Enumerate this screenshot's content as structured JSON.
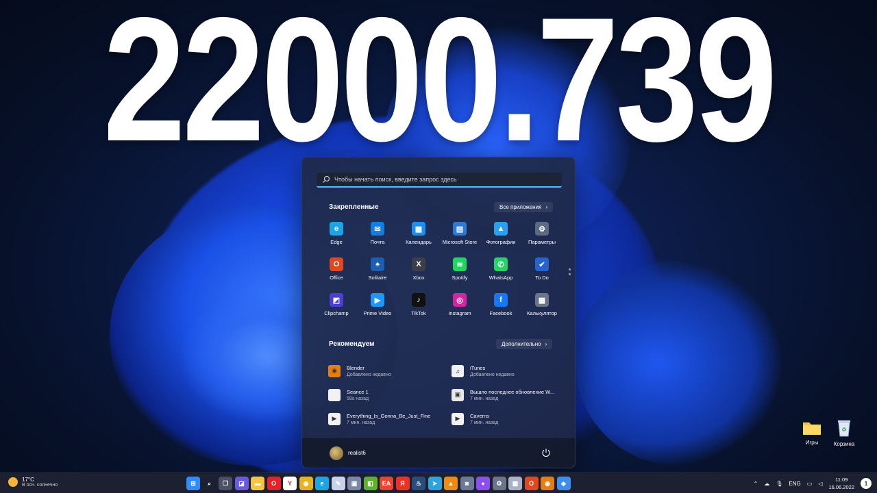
{
  "headline": "22000.739",
  "start_menu": {
    "search_placeholder": "Чтобы начать поиск, введите запрос здесь",
    "pinned_title": "Закрепленные",
    "all_apps_label": "Все приложения",
    "recommended_title": "Рекомендуем",
    "more_label": "Дополнительно",
    "pinned": [
      {
        "label": "Edge",
        "icon": "edge-icon",
        "color": "#1aa5e6",
        "glyph": "e"
      },
      {
        "label": "Почта",
        "icon": "mail-icon",
        "color": "#0f7fe0",
        "glyph": "✉"
      },
      {
        "label": "Календарь",
        "icon": "calendar-icon",
        "color": "#1e8ef0",
        "glyph": "▦"
      },
      {
        "label": "Microsoft Store",
        "icon": "store-icon",
        "color": "#2b7ad6",
        "glyph": "▤"
      },
      {
        "label": "Фотографии",
        "icon": "photos-icon",
        "color": "#2aa0f0",
        "glyph": "▲"
      },
      {
        "label": "Параметры",
        "icon": "settings-icon",
        "color": "#5d6a82",
        "glyph": "⚙"
      },
      {
        "label": "Office",
        "icon": "office-icon",
        "color": "#e2481f",
        "glyph": "O"
      },
      {
        "label": "Solitaire",
        "icon": "solitaire-icon",
        "color": "#1b5fb5",
        "glyph": "♠"
      },
      {
        "label": "Xbox",
        "icon": "xbox-icon",
        "color": "#3a3f4a",
        "glyph": "X"
      },
      {
        "label": "Spotify",
        "icon": "spotify-icon",
        "color": "#1ed760",
        "glyph": "≋"
      },
      {
        "label": "WhatsApp",
        "icon": "whatsapp-icon",
        "color": "#25d366",
        "glyph": "✆"
      },
      {
        "label": "To Do",
        "icon": "todo-icon",
        "color": "#2564cf",
        "glyph": "✔"
      },
      {
        "label": "Clipchamp",
        "icon": "clipchamp-icon",
        "color": "#4b3fd6",
        "glyph": "◩"
      },
      {
        "label": "Prime Video",
        "icon": "prime-video-icon",
        "color": "#1a98ff",
        "glyph": "▶"
      },
      {
        "label": "TikTok",
        "icon": "tiktok-icon",
        "color": "#111111",
        "glyph": "♪"
      },
      {
        "label": "Instagram",
        "icon": "instagram-icon",
        "color": "#d6249f",
        "glyph": "◎"
      },
      {
        "label": "Facebook",
        "icon": "facebook-icon",
        "color": "#1877f2",
        "glyph": "f"
      },
      {
        "label": "Калькулятор",
        "icon": "calculator-icon",
        "color": "#6b7589",
        "glyph": "▦"
      }
    ],
    "recommended": [
      {
        "name": "Blender",
        "sub": "Добавлено недавно",
        "icon": "blender-icon",
        "color": "#e87d0d",
        "glyph": "◉"
      },
      {
        "name": "iTunes",
        "sub": "Добавлено недавно",
        "icon": "itunes-icon",
        "color": "#f0f0f5",
        "glyph": "♫"
      },
      {
        "name": "Seance 1",
        "sub": "58s назад",
        "icon": "document-icon",
        "color": "#f2f2f2",
        "glyph": ""
      },
      {
        "name": "Вышло последнее обновление W...",
        "sub": "7 мин. назад",
        "icon": "image-file-icon",
        "color": "#e8e8e8",
        "glyph": "▣"
      },
      {
        "name": "Everything_Is_Gonna_Be_Just_Fine",
        "sub": "7 мин. назад",
        "icon": "video-file-icon",
        "color": "#f2f2f2",
        "glyph": "▶"
      },
      {
        "name": "Caverns",
        "sub": "7 мин. назад",
        "icon": "video-file-icon",
        "color": "#f2f2f2",
        "glyph": "▶"
      }
    ],
    "user": "realist6"
  },
  "desktop": [
    {
      "label": "Игры",
      "icon": "folder-icon"
    },
    {
      "label": "Корзина",
      "icon": "recycle-bin-icon"
    }
  ],
  "taskbar": {
    "weather_temp": "17°C",
    "weather_desc": "В осн. солнечно",
    "apps": [
      {
        "icon": "start-icon",
        "color": "#2f8cff",
        "glyph": "⊞"
      },
      {
        "icon": "search-icon",
        "color": "transparent",
        "glyph": "⌕"
      },
      {
        "icon": "task-view-icon",
        "color": "#4a5166",
        "glyph": "❐"
      },
      {
        "icon": "chat-icon",
        "color": "#6a5ae0",
        "glyph": "◪"
      },
      {
        "icon": "explorer-icon",
        "color": "#f5c542",
        "glyph": "▬"
      },
      {
        "icon": "opera-icon",
        "color": "#e8202a",
        "glyph": "O"
      },
      {
        "icon": "yandex-icon",
        "color": "#ffffff",
        "glyph": "Y"
      },
      {
        "icon": "chrome-icon",
        "color": "#e8b21c",
        "glyph": "◉"
      },
      {
        "icon": "edge-icon",
        "color": "#1aa5e6",
        "glyph": "e"
      },
      {
        "icon": "paint-icon",
        "color": "#c8d2e8",
        "glyph": "✎"
      },
      {
        "icon": "photos-icon",
        "color": "#7a88a6",
        "glyph": "▣"
      },
      {
        "icon": "nvidia-icon",
        "color": "#5fb32b",
        "glyph": "◧"
      },
      {
        "icon": "ea-icon",
        "color": "#e8452c",
        "glyph": "EA"
      },
      {
        "icon": "yandex-browser-icon",
        "color": "#ef3124",
        "glyph": "Я"
      },
      {
        "icon": "steam-icon",
        "color": "#2a4c7a",
        "glyph": "♨"
      },
      {
        "icon": "telegram-icon",
        "color": "#2aa3df",
        "glyph": "➤"
      },
      {
        "icon": "vlc-icon",
        "color": "#f08a12",
        "glyph": "▲"
      },
      {
        "icon": "camera-icon",
        "color": "#6d7a96",
        "glyph": "◙"
      },
      {
        "icon": "alice-icon",
        "color": "#8c4ef0",
        "glyph": "●"
      },
      {
        "icon": "settings-icon",
        "color": "#6b7589",
        "glyph": "⚙"
      },
      {
        "icon": "calculator-icon",
        "color": "#aab2c4",
        "glyph": "▦"
      },
      {
        "icon": "office-icon",
        "color": "#e2481f",
        "glyph": "O"
      },
      {
        "icon": "blender-icon",
        "color": "#e87d0d",
        "glyph": "◉"
      },
      {
        "icon": "phone-link-icon",
        "color": "#3a8ef0",
        "glyph": "◈"
      }
    ],
    "lang": "ENG",
    "time": "11:09",
    "date": "16.06.2022",
    "notifications": "1"
  }
}
